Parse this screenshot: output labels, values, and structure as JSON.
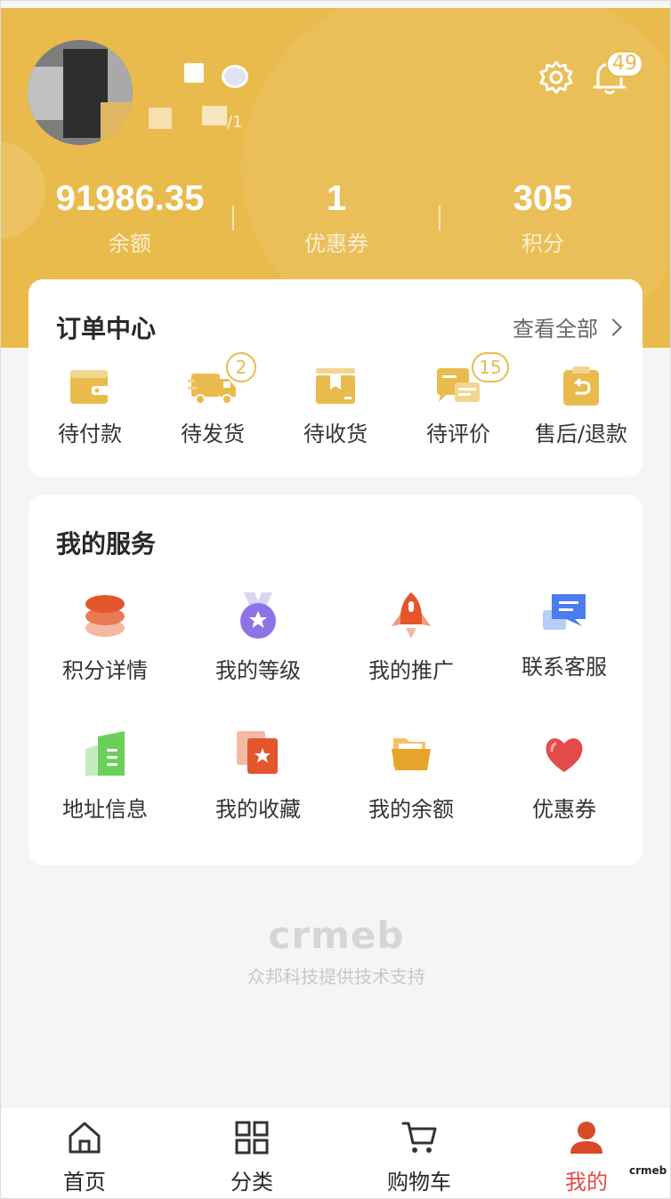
{
  "header": {
    "id_suffix": "/1",
    "notification_count": "49"
  },
  "stats": [
    {
      "value": "91986.35",
      "label": "余额"
    },
    {
      "value": "1",
      "label": "优惠券"
    },
    {
      "value": "305",
      "label": "积分"
    }
  ],
  "orders": {
    "title": "订单中心",
    "view_all": "查看全部",
    "items": [
      {
        "label": "待付款",
        "icon": "wallet-icon"
      },
      {
        "label": "待发货",
        "icon": "delivery-truck-icon",
        "badge": "2"
      },
      {
        "label": "待收货",
        "icon": "package-box-icon"
      },
      {
        "label": "待评价",
        "icon": "review-chat-icon",
        "badge": "15"
      },
      {
        "label": "售后/退款",
        "icon": "refund-clipboard-icon"
      }
    ]
  },
  "services": {
    "title": "我的服务",
    "items": [
      {
        "label": "积分详情",
        "icon": "points-stack-icon"
      },
      {
        "label": "我的等级",
        "icon": "medal-icon"
      },
      {
        "label": "我的推广",
        "icon": "rocket-icon"
      },
      {
        "label": "联系客服",
        "icon": "customer-service-chat-icon"
      },
      {
        "label": "地址信息",
        "icon": "address-book-icon"
      },
      {
        "label": "我的收藏",
        "icon": "favorite-star-icon"
      },
      {
        "label": "我的余额",
        "icon": "folder-icon"
      },
      {
        "label": "优惠券",
        "icon": "heart-coupon-icon"
      }
    ]
  },
  "brand": {
    "logo": "crmeb",
    "tagline": "众邦科技提供技术支持",
    "mini_logo": "crmeb"
  },
  "tabbar": [
    {
      "label": "首页",
      "icon": "home-icon"
    },
    {
      "label": "分类",
      "icon": "category-grid-icon"
    },
    {
      "label": "购物车",
      "icon": "cart-icon"
    },
    {
      "label": "我的",
      "icon": "user-icon",
      "active": true
    }
  ],
  "colors": {
    "header": "#e9bb4d",
    "accent_active": "#e04a4a",
    "background": "#f5f5f5"
  }
}
